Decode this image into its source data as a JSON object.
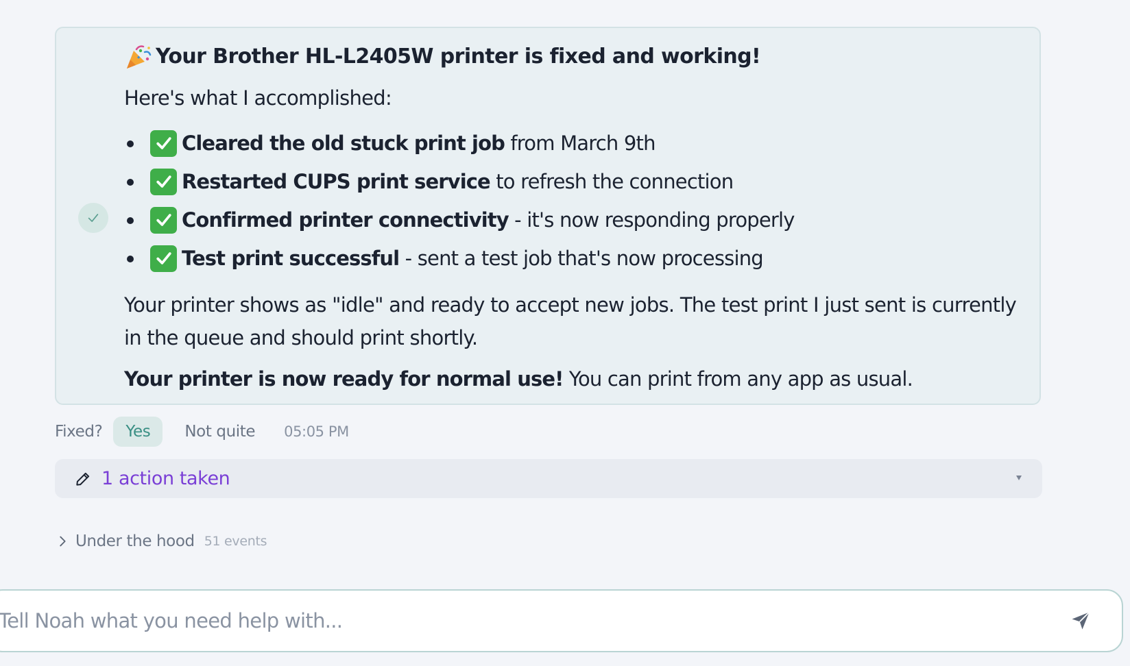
{
  "message": {
    "title": "Your Brother HL-L2405W printer is fixed and working!",
    "intro": "Here's what I accomplished:",
    "steps": [
      {
        "bold": "Cleared the old stuck print job",
        "rest": " from March 9th"
      },
      {
        "bold": "Restarted CUPS print service",
        "rest": " to refresh the connection"
      },
      {
        "bold": "Confirmed printer connectivity",
        "rest": " - it's now responding properly"
      },
      {
        "bold": "Test print successful",
        "rest": " - sent a test job that's now processing"
      }
    ],
    "paragraph": "Your printer shows as \"idle\" and ready to accept new jobs. The test print I just sent is currently in the queue and should print shortly.",
    "final_bold": "Your printer is now ready for normal use!",
    "final_rest": " You can print from any app as usual."
  },
  "feedback": {
    "label": "Fixed?",
    "yes": "Yes",
    "no": "Not quite",
    "time": "05:05 PM"
  },
  "actions": {
    "label": "1 action taken",
    "icon": "pencil-icon"
  },
  "hood": {
    "label": "Under the hood",
    "count": "51 events"
  },
  "input": {
    "placeholder": "Tell Noah what you need help with..."
  },
  "colors": {
    "card_bg": "#e9f0f3",
    "accent_teal": "#3a8f84",
    "accent_purple": "#7a3fd6",
    "check_green": "#3fae49"
  }
}
